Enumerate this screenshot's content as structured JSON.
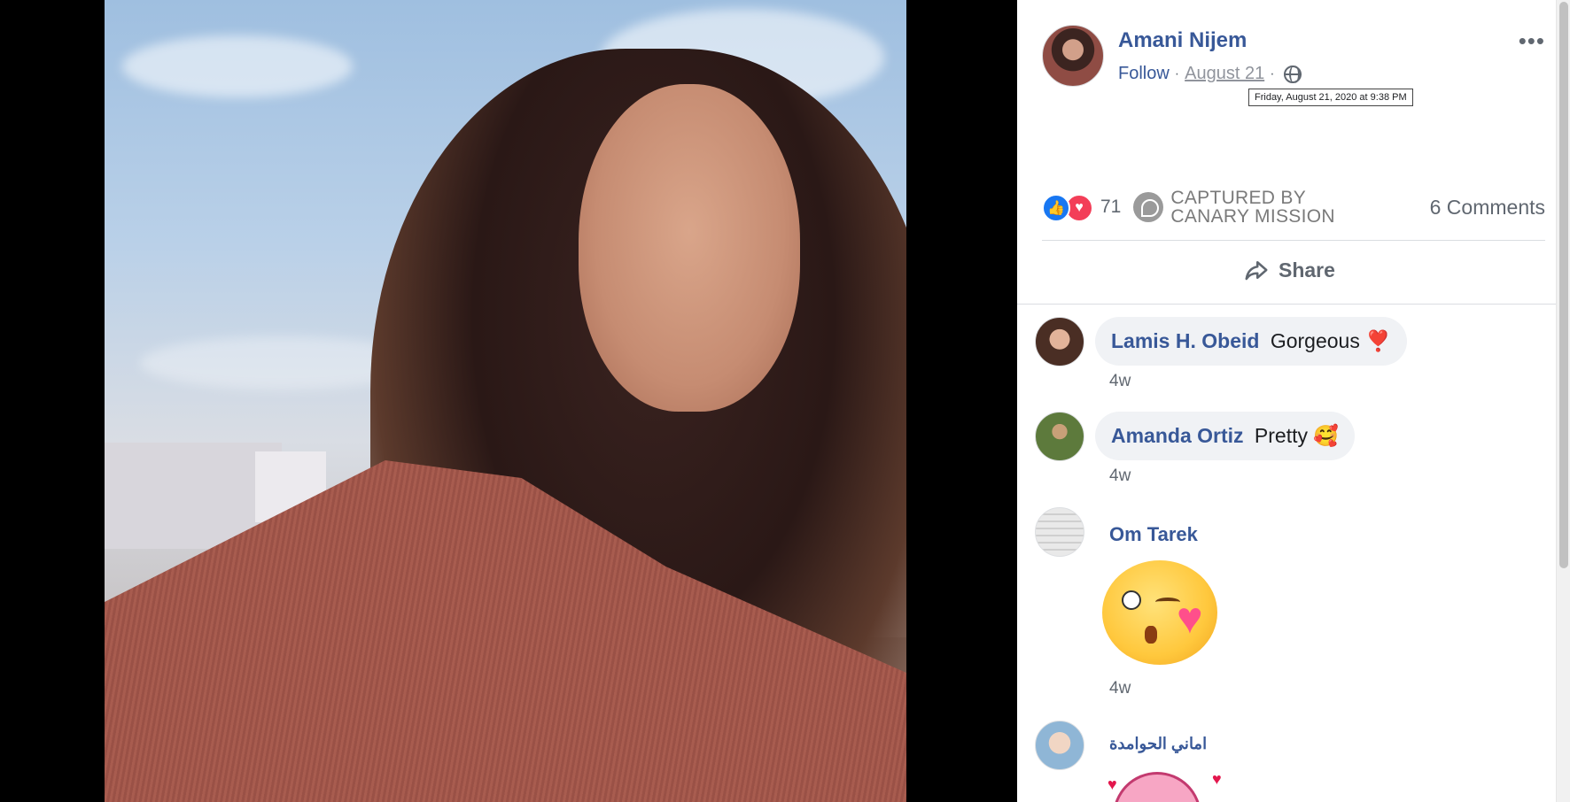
{
  "post": {
    "author": "Amani Nijem",
    "follow_label": "Follow",
    "separator": "·",
    "date": "August 21",
    "date_tooltip": "Friday, August 21, 2020 at 9:38 PM",
    "more_label": "•••",
    "privacy_icon": "globe-icon"
  },
  "stats": {
    "reaction_count": "71",
    "reaction_icons": [
      "like-icon",
      "love-icon"
    ],
    "watermark_line1": "CAPTURED BY",
    "watermark_line2": "CANARY MISSION",
    "comments_label": "6 Comments"
  },
  "actions": {
    "share_label": "Share"
  },
  "comments": [
    {
      "name": "Lamis H. Obeid",
      "text": "Gorgeous ❣️",
      "time": "4w"
    },
    {
      "name": "Amanda Ortiz",
      "text": "Pretty 🥰",
      "time": "4w"
    },
    {
      "name": "Om Tarek",
      "text": "",
      "time": "4w",
      "sticker": "kiss-wink-emoji"
    },
    {
      "name": "اماني الحوامدة",
      "text": "",
      "sticker": "pink-character-sticker"
    }
  ],
  "colors": {
    "link": "#385898",
    "secondary_text": "#606770",
    "like": "#1877f2",
    "love": "#f33e58",
    "bubble": "#f0f2f5"
  }
}
